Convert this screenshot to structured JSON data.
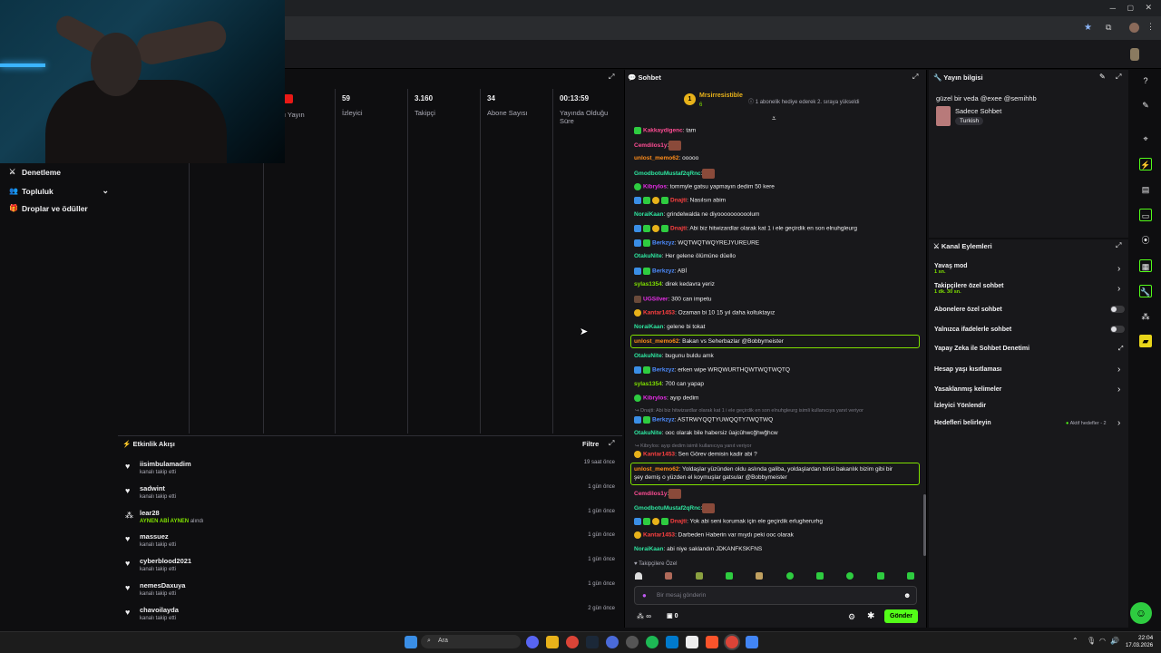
{
  "stats": [
    {
      "value": "",
      "label": "ı Yayın"
    },
    {
      "value": "59",
      "label": "İzleyici"
    },
    {
      "value": "3.160",
      "label": "Takipçi"
    },
    {
      "value": "34",
      "label": "Abone Sayısı"
    },
    {
      "value": "00:13:59",
      "label": "Yayında Olduğu Süre"
    }
  ],
  "left_nav": [
    "Denetleme",
    "Topluluk",
    "Droplar ve ödüller"
  ],
  "activity": {
    "title": "Etkinlik Akışı",
    "filter": "Filtre",
    "items": [
      {
        "name": "iisimbulamadim",
        "desc": "kanalı takip etti",
        "time": "19 saat önce"
      },
      {
        "name": "sadwint",
        "desc": "kanalı takip etti",
        "time": "1 gün önce"
      },
      {
        "name": "lear28",
        "desc": "AYNEN ABİ AYNEN",
        "desc2": "alındı",
        "time": "1 gün önce"
      },
      {
        "name": "massuez",
        "desc": "kanalı takip etti",
        "time": "1 gün önce"
      },
      {
        "name": "cyberblood2021",
        "desc": "kanalı takip etti",
        "time": "1 gün önce"
      },
      {
        "name": "nemesDaxuya",
        "desc": "kanalı takip etti",
        "time": "1 gün önce"
      },
      {
        "name": "chavoilayda",
        "desc": "kanalı takip etti",
        "time": "2 gün önce"
      }
    ]
  },
  "chat": {
    "title": "Sohbet",
    "pinned_user": "Mrsirresistible",
    "pinned_count": "6",
    "pinned_text": "1 abonelik hediye ederek 2. sıraya yükseldi",
    "messages": [
      {
        "user": "Kakkaydigenc",
        "text": ": tam",
        "color": "#ff4d94"
      },
      {
        "user": "Cemdilos1y",
        "text": ":",
        "color": "#ff4d94"
      },
      {
        "user": "unlost_memo62",
        "text": ": ooooo",
        "color": "#ff8c1a"
      },
      {
        "user": "GmodbotuMustaf2qRnc",
        "text": ":",
        "color": "#2ee6a0"
      },
      {
        "user": "Kibrylos",
        "text": ": tommyle gatsu yapmayın dedim 50 kere",
        "color": "#e62ee6"
      },
      {
        "user": "Dnajti",
        "text": ": Nasılsın abim",
        "color": "#ff4040"
      },
      {
        "user": "NoraiKaan",
        "text": ": grindelwalda ne diyoooooooooolum",
        "color": "#2ee6a0"
      },
      {
        "user": "Dnajti",
        "text": ": Abi biz hitwizardlar olarak kat 1 i ele geçirdik en son elnuhgleurg",
        "color": "#ff4040"
      },
      {
        "user": "Berkzyz",
        "text": ": WQTWQTWQYREJYUREURE",
        "color": "#4d8cff"
      },
      {
        "user": "OtakuNite",
        "text": ": Her gelene ölümüne düello",
        "color": "#2ee6a0"
      },
      {
        "user": "Berkzyz",
        "text": ": ABİ",
        "color": "#4d8cff"
      },
      {
        "user": "sylas1354",
        "text": ": direk kedavra yeriz",
        "color": "#7fe000"
      },
      {
        "user": "UGSilver",
        "text": ": 300 can impetu",
        "color": "#e62ee6"
      },
      {
        "user": "Kantar1453",
        "text": ": Ozaman bi 10 15 yıl daha koltuktayız",
        "color": "#ff4040"
      },
      {
        "user": "NoraiKaan",
        "text": ": gelene bi tokat",
        "color": "#2ee6a0"
      },
      {
        "user": "unlost_memo62",
        "text": ": Bakan vs Seherbazlar @Bobbymeister",
        "color": "#ff8c1a"
      },
      {
        "user": "OtakuNite",
        "text": ": bugunu buldu amk",
        "color": "#2ee6a0"
      },
      {
        "user": "Berkzyz",
        "text": ": erken wipe WRQWURTHQWTWQTWQTQ",
        "color": "#4d8cff"
      },
      {
        "user": "sylas1354",
        "text": ": 700 can yapap",
        "color": "#7fe000"
      },
      {
        "user": "Kibrylos",
        "text": ": ayıp dedim",
        "color": "#e62ee6"
      },
      {
        "user": "Berkzyz",
        "text": ": ASTRWYQQTYUWQQTY7WQTWQ",
        "color": "#4d8cff"
      },
      {
        "user": "OtakuNite",
        "text": ": ooc olarak bile habersiz ûajcûhwcğhwğhcw",
        "color": "#2ee6a0"
      },
      {
        "user": "Kantar1453",
        "text": ": Sen Görev demisin kadir abi ?",
        "color": "#ff4040"
      },
      {
        "user": "unlost_memo62",
        "text": ": Yoldaşlar yüzünden oldu aslında galiba, yoldaşlardan birisi bakanlık bizim gibi bir",
        "text2": "şey demiş o yüzden el koymuşlar gatsular @Bobbymeister",
        "color": "#ff8c1a"
      },
      {
        "user": "Cemdilos1y",
        "text": ":",
        "color": "#ff4d94"
      },
      {
        "user": "GmodbotuMustaf2qRnc",
        "text": ":",
        "color": "#2ee6a0"
      },
      {
        "user": "Dnajti",
        "text": ": Yok abi seni korumak için ele geçirdik erlugherurhg",
        "color": "#ff4040"
      },
      {
        "user": "Kantar1453",
        "text": ": Darbeden Haberin var mıydı peki ooc olarak",
        "color": "#ff4040"
      },
      {
        "user": "NoraiKaan",
        "text": ": abi niye saklandın JDKANFKSKFNS",
        "color": "#2ee6a0"
      }
    ],
    "reply1": "Dnajti: Abi biz hitwizardlar olarak kat 1 i ele geçirdik en son elnuhgleurg isimli kullanıcıya yanıt veriyor",
    "reply2": "Kibrylos: ayıp dedim isimli kullanıcıya yanıt veriyor",
    "followers_only": "Takipçilere Özel",
    "input_placeholder": "Bir mesaj gönderin",
    "points": "∞",
    "count": "0",
    "send": "Gönder"
  },
  "stream_info": {
    "title": "Yayın bilgisi",
    "stream_title": "güzel bir veda @exee @semihhb",
    "category": "Sadece Sohbet",
    "tag": "Turkish"
  },
  "channel_actions": {
    "title": "Kanal Eylemleri",
    "items": [
      {
        "label": "Yavaş mod",
        "sub": "1 sn."
      },
      {
        "label": "Takipçilere özel sohbet",
        "sub": "1 dk. 30 sn."
      },
      {
        "label": "Abonelere özel sohbet",
        "sub": ""
      },
      {
        "label": "Yalnızca ifadelerle sohbet",
        "sub": ""
      },
      {
        "label": "Yapay Zeka ile Sohbet Denetimi",
        "sub": ""
      },
      {
        "label": "Hesap yaşı kısıtlaması",
        "sub": ""
      },
      {
        "label": "Yasaklanmış kelimeler",
        "sub": ""
      },
      {
        "label": "İzleyici Yönlendir",
        "sub": ""
      },
      {
        "label": "Hedefleri belirleyin",
        "sub": ""
      }
    ],
    "goals_status": "Aktif hedefler - 2"
  },
  "taskbar": {
    "search": "Ara",
    "time": "22:04",
    "date": "17.03.2026"
  }
}
